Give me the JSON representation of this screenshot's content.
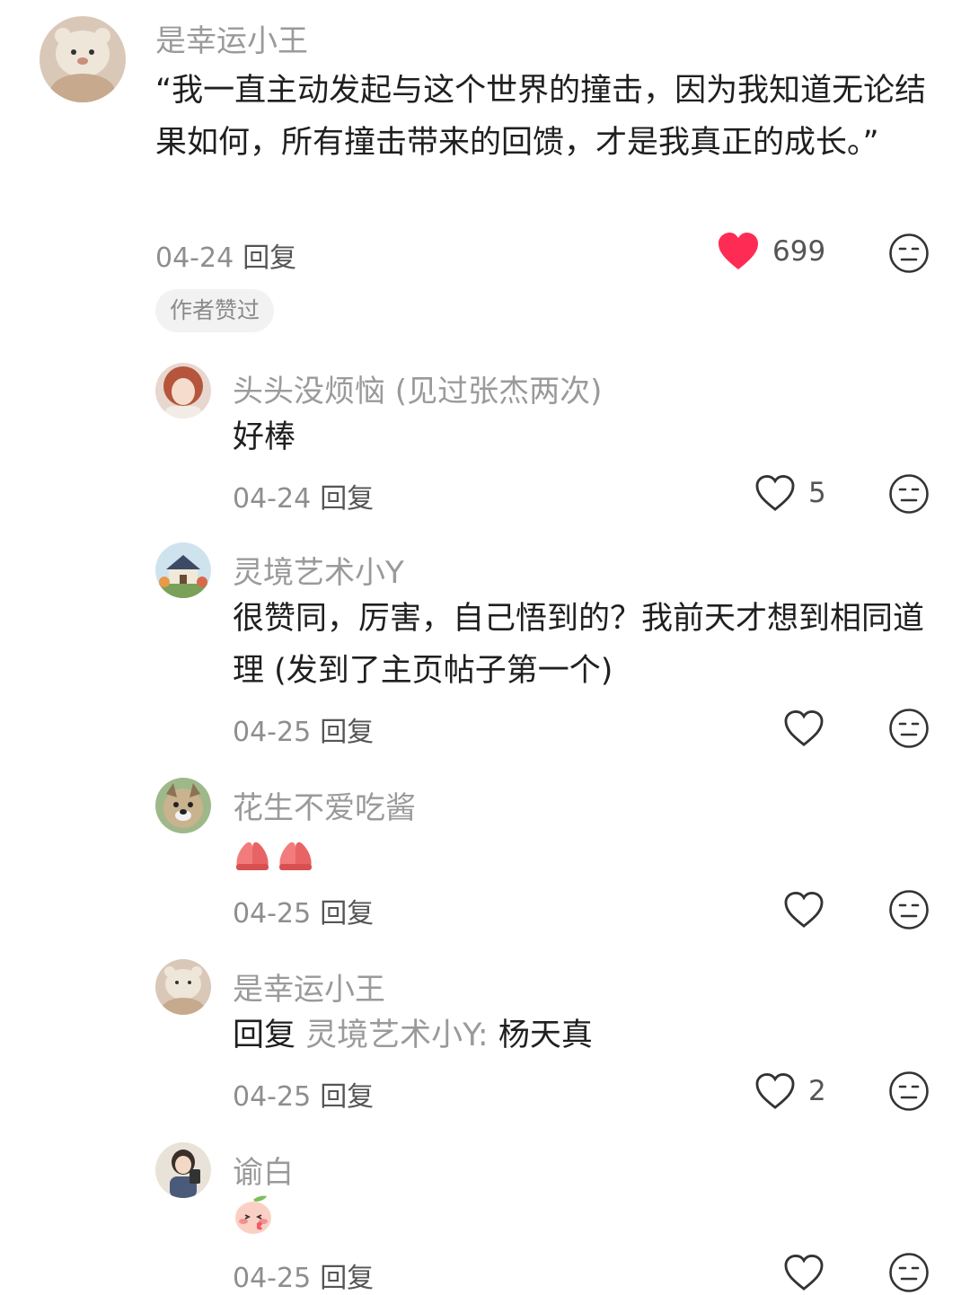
{
  "comments": [
    {
      "id": "main",
      "name": "是幸运小王",
      "text": "“我一直主动发起与这个世界的撞击，因为我知道无论结果如何，所有撞击带来的回馈，才是我真正的成长。”",
      "date": "04-24",
      "reply_label": "回复",
      "likes": "699",
      "liked": true,
      "badge": "作者赞过"
    },
    {
      "id": "r1",
      "name": "头头没烦恼 (见过张杰两次)",
      "text": "好棒",
      "date": "04-24",
      "reply_label": "回复",
      "likes": "5"
    },
    {
      "id": "r2",
      "name": "灵境艺术小Y",
      "text": "很赞同，厉害，自己悟到的？我前天才想到相同道理 (发到了主页帖子第一个)",
      "date": "04-25",
      "reply_label": "回复",
      "likes": ""
    },
    {
      "id": "r3",
      "name": "花生不爱吃酱",
      "emoji": "praying-hands",
      "date": "04-25",
      "reply_label": "回复",
      "likes": ""
    },
    {
      "id": "r4",
      "name": "是幸运小王",
      "reply_prefix": "回复",
      "reply_to": "灵境艺术小Y:",
      "text": "杨天真",
      "date": "04-25",
      "reply_label": "回复",
      "likes": "2"
    },
    {
      "id": "r5",
      "name": "谕白",
      "emoji": "blushing-peach",
      "date": "04-25",
      "reply_label": "回复",
      "likes": ""
    }
  ],
  "colors": {
    "like_red": "#fe2c55",
    "meta_gray": "#8e8e8e",
    "name_gray": "#9a9a9a"
  }
}
